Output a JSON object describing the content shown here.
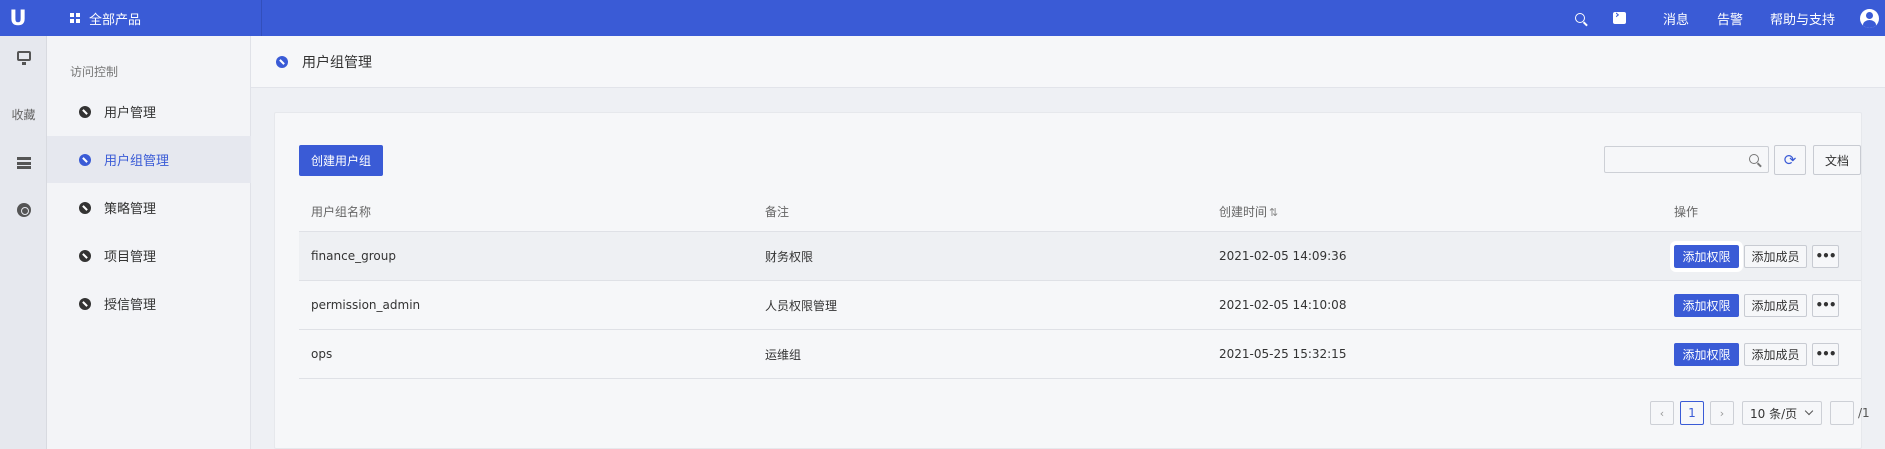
{
  "topbar": {
    "logo": "U",
    "all_products": "全部产品",
    "messages": "消息",
    "alerts": "告警",
    "help": "帮助与支持"
  },
  "rail": {
    "favorites": "收藏"
  },
  "sidemenu": {
    "title": "访问控制",
    "items": [
      {
        "label": "用户管理",
        "active": false
      },
      {
        "label": "用户组管理",
        "active": true
      },
      {
        "label": "策略管理",
        "active": false
      },
      {
        "label": "项目管理",
        "active": false
      },
      {
        "label": "授信管理",
        "active": false
      }
    ]
  },
  "page": {
    "title": "用户组管理"
  },
  "toolbar": {
    "create_label": "创建用户组",
    "search_placeholder": "",
    "doc_label": "文档"
  },
  "table": {
    "headers": {
      "name": "用户组名称",
      "note": "备注",
      "time": "创建时间",
      "op": "操作"
    },
    "rows": [
      {
        "name": "finance_group",
        "note": "财务权限",
        "time": "2021-02-05 14:09:36"
      },
      {
        "name": "permission_admin",
        "note": "人员权限管理",
        "time": "2021-02-05 14:10:08"
      },
      {
        "name": "ops",
        "note": "运维组",
        "time": "2021-05-25 15:32:15"
      }
    ],
    "actions": {
      "add_perm": "添加权限",
      "add_member": "添加成员",
      "more": "•••"
    }
  },
  "pagination": {
    "prev": "‹",
    "current": "1",
    "next": "›",
    "page_size": "10 条/页",
    "total": "/1"
  },
  "colors": {
    "primary": "#3a5bd6"
  }
}
